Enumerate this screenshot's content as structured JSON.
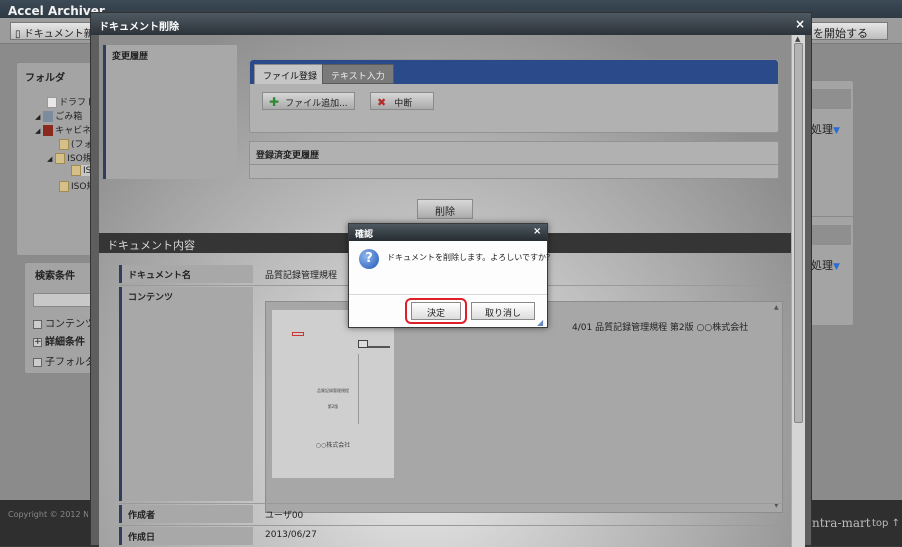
{
  "app": {
    "title": "Accel Archiver",
    "new_doc_label": "ドキュメント新規",
    "start_label": "を開始する",
    "copyright": "Copyright © 2012 NTT DATA",
    "brand": "ntra-mart",
    "top_link": "top ↑"
  },
  "background": {
    "folder_title": "フォルダ",
    "tree": [
      {
        "label": "ドラフト"
      },
      {
        "label": "ごみ箱"
      },
      {
        "label": "キャビネット"
      },
      {
        "label": "(フォルダ)"
      },
      {
        "label": "ISO規程"
      },
      {
        "label": "ISO"
      },
      {
        "label": "ISO規"
      }
    ],
    "search_title": "検索条件",
    "content_check": "コンテンツ",
    "detail_label": "詳細条件",
    "subfolder_check": "子フォルダ",
    "batch_label_1": "処理",
    "batch_label_2": "処理"
  },
  "dialog": {
    "title": "ドキュメント削除",
    "close": "×",
    "history_label": "変更履歴",
    "tabs": [
      {
        "label": "ファイル登録"
      },
      {
        "label": "テキスト入力"
      }
    ],
    "add_file_label": "ファイル追加...",
    "abort_label": "中断",
    "registered_history_label": "登録済変更履歴",
    "delete_label": "削除",
    "doc_section_title": "ドキュメント内容",
    "doc_name_key": "ドキュメント名",
    "doc_name_value": "品質記録管理規程",
    "contents_key": "コンテンツ",
    "contents_text": "4/01 品質記録管理規程 第2版 ○○株式会社",
    "thumb_title": "品質記録管理規程",
    "thumb_edition": "第2版",
    "thumb_company": "○○株式会社",
    "author_key": "作成者",
    "author_value": "ユーザ00",
    "created_key": "作成日",
    "created_value": "2013/06/27"
  },
  "confirm": {
    "title": "確認",
    "close": "×",
    "message": "ドキュメントを削除します。よろしいですか？",
    "ok_label": "決定",
    "cancel_label": "取り消し"
  },
  "colors": {
    "tab_bar": "#2a4a8a",
    "highlight_ring": "#e01e2a",
    "question_icon": "#1f56b4"
  }
}
